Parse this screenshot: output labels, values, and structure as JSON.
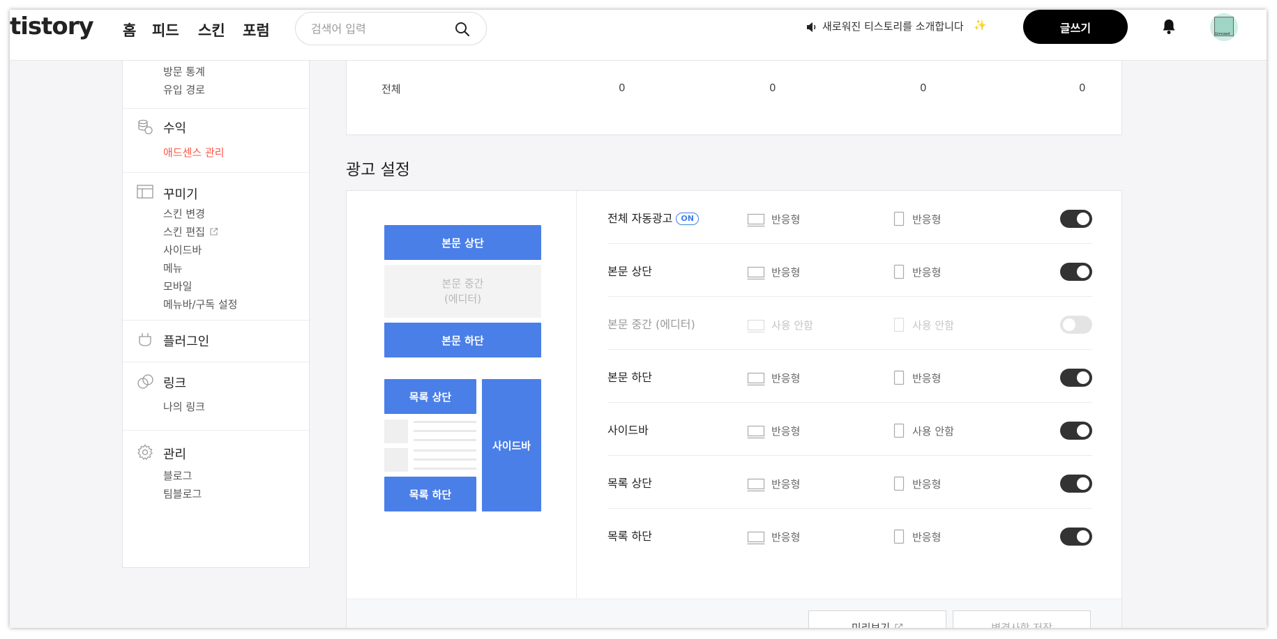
{
  "header": {
    "logo": "tistory",
    "nav": [
      "홈",
      "피드",
      "스킨",
      "포럼"
    ],
    "search_placeholder": "검색어 입력",
    "notice": "새로워진 티스토리를 소개합니다",
    "sparkle": "✨",
    "write_label": "글쓰기",
    "avatar_caption": "Grnnaed"
  },
  "sidebar": {
    "stats_items": [
      "방문 통계",
      "유입 경로"
    ],
    "revenue": {
      "title": "수익",
      "items": [
        "애드센스 관리"
      ]
    },
    "decorate": {
      "title": "꾸미기",
      "items": [
        "스킨 변경",
        "스킨 편집",
        "사이드바",
        "메뉴",
        "모바일",
        "메뉴바/구독 설정"
      ]
    },
    "plugin": {
      "title": "플러그인"
    },
    "link": {
      "title": "링크",
      "items": [
        "나의 링크"
      ]
    },
    "manage": {
      "title": "관리",
      "items": [
        "블로그",
        "팀블로그"
      ]
    }
  },
  "summary": {
    "label": "전체",
    "values": [
      "0",
      "0",
      "0",
      "0"
    ]
  },
  "ad_settings": {
    "title": "광고 설정",
    "preview": {
      "body_top": "본문 상단",
      "body_middle_1": "본문 중간",
      "body_middle_2": "(에디터)",
      "body_bottom": "본문 하단",
      "list_top": "목록 상단",
      "list_bottom": "목록 하단",
      "sidebar": "사이드바"
    },
    "on_badge": "ON",
    "rows": [
      {
        "name": "전체 자동광고",
        "pc": "반응형",
        "mobile": "반응형",
        "enabled": true
      },
      {
        "name": "본문 상단",
        "pc": "반응형",
        "mobile": "반응형",
        "enabled": true
      },
      {
        "name": "본문 중간 (에디터)",
        "pc": "사용 안함",
        "mobile": "사용 안함",
        "enabled": false
      },
      {
        "name": "본문 하단",
        "pc": "반응형",
        "mobile": "반응형",
        "enabled": true
      },
      {
        "name": "사이드바",
        "pc": "반응형",
        "mobile": "사용 안함",
        "enabled": true
      },
      {
        "name": "목록 상단",
        "pc": "반응형",
        "mobile": "반응형",
        "enabled": true
      },
      {
        "name": "목록 하단",
        "pc": "반응형",
        "mobile": "반응형",
        "enabled": true
      }
    ],
    "preview_button": "미리보기",
    "save_button": "변경사항 저장"
  },
  "colors": {
    "accent_blue": "#4a7fe8",
    "active_red": "#ff5544",
    "toggle_on": "#333333"
  }
}
